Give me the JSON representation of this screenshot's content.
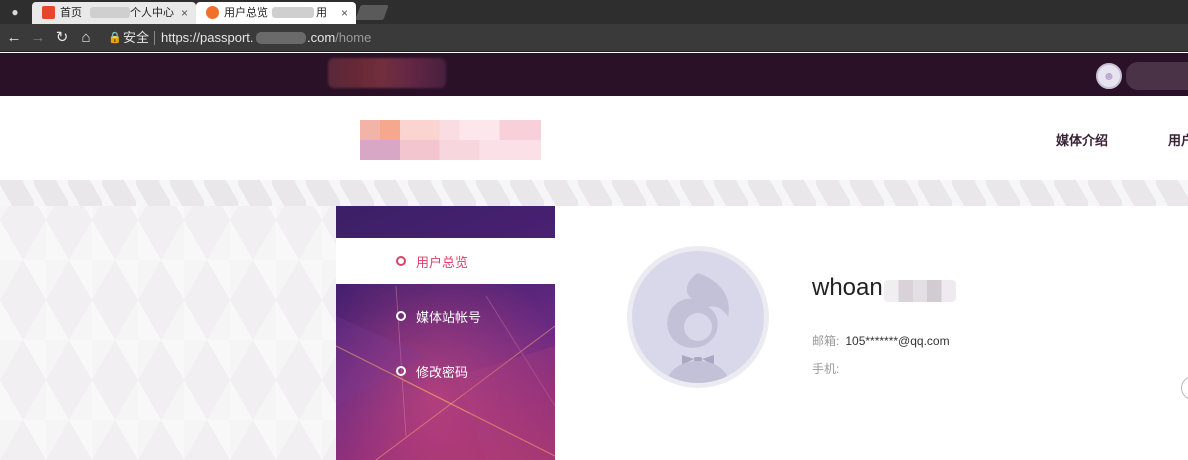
{
  "browser": {
    "tabs": [
      {
        "title": "首页",
        "title_suffix": "个人中心",
        "active": false,
        "favicon_color": "#e8452f"
      },
      {
        "title": "用户总览",
        "title_suffix": "用",
        "active": true,
        "favicon_color": "#f0702a"
      }
    ],
    "close_glyph": "×",
    "address": {
      "secure_label": "安全",
      "url_prefix": "https://passport.",
      "url_domain_suffix": ".com",
      "url_path": "/home"
    }
  },
  "site": {
    "nav": [
      "媒体介绍",
      "用户"
    ],
    "sidemenu": [
      {
        "label": "用户总览",
        "active": true
      },
      {
        "label": "媒体站帐号",
        "active": false
      },
      {
        "label": "修改密码",
        "active": false
      }
    ],
    "profile": {
      "username": "whoan",
      "email_label": "邮箱:",
      "email_value": "105*******@qq.com",
      "phone_label": "手机:",
      "phone_value": ""
    },
    "colors": {
      "accent": "#d9436b",
      "topbar": "#2b1128"
    }
  }
}
